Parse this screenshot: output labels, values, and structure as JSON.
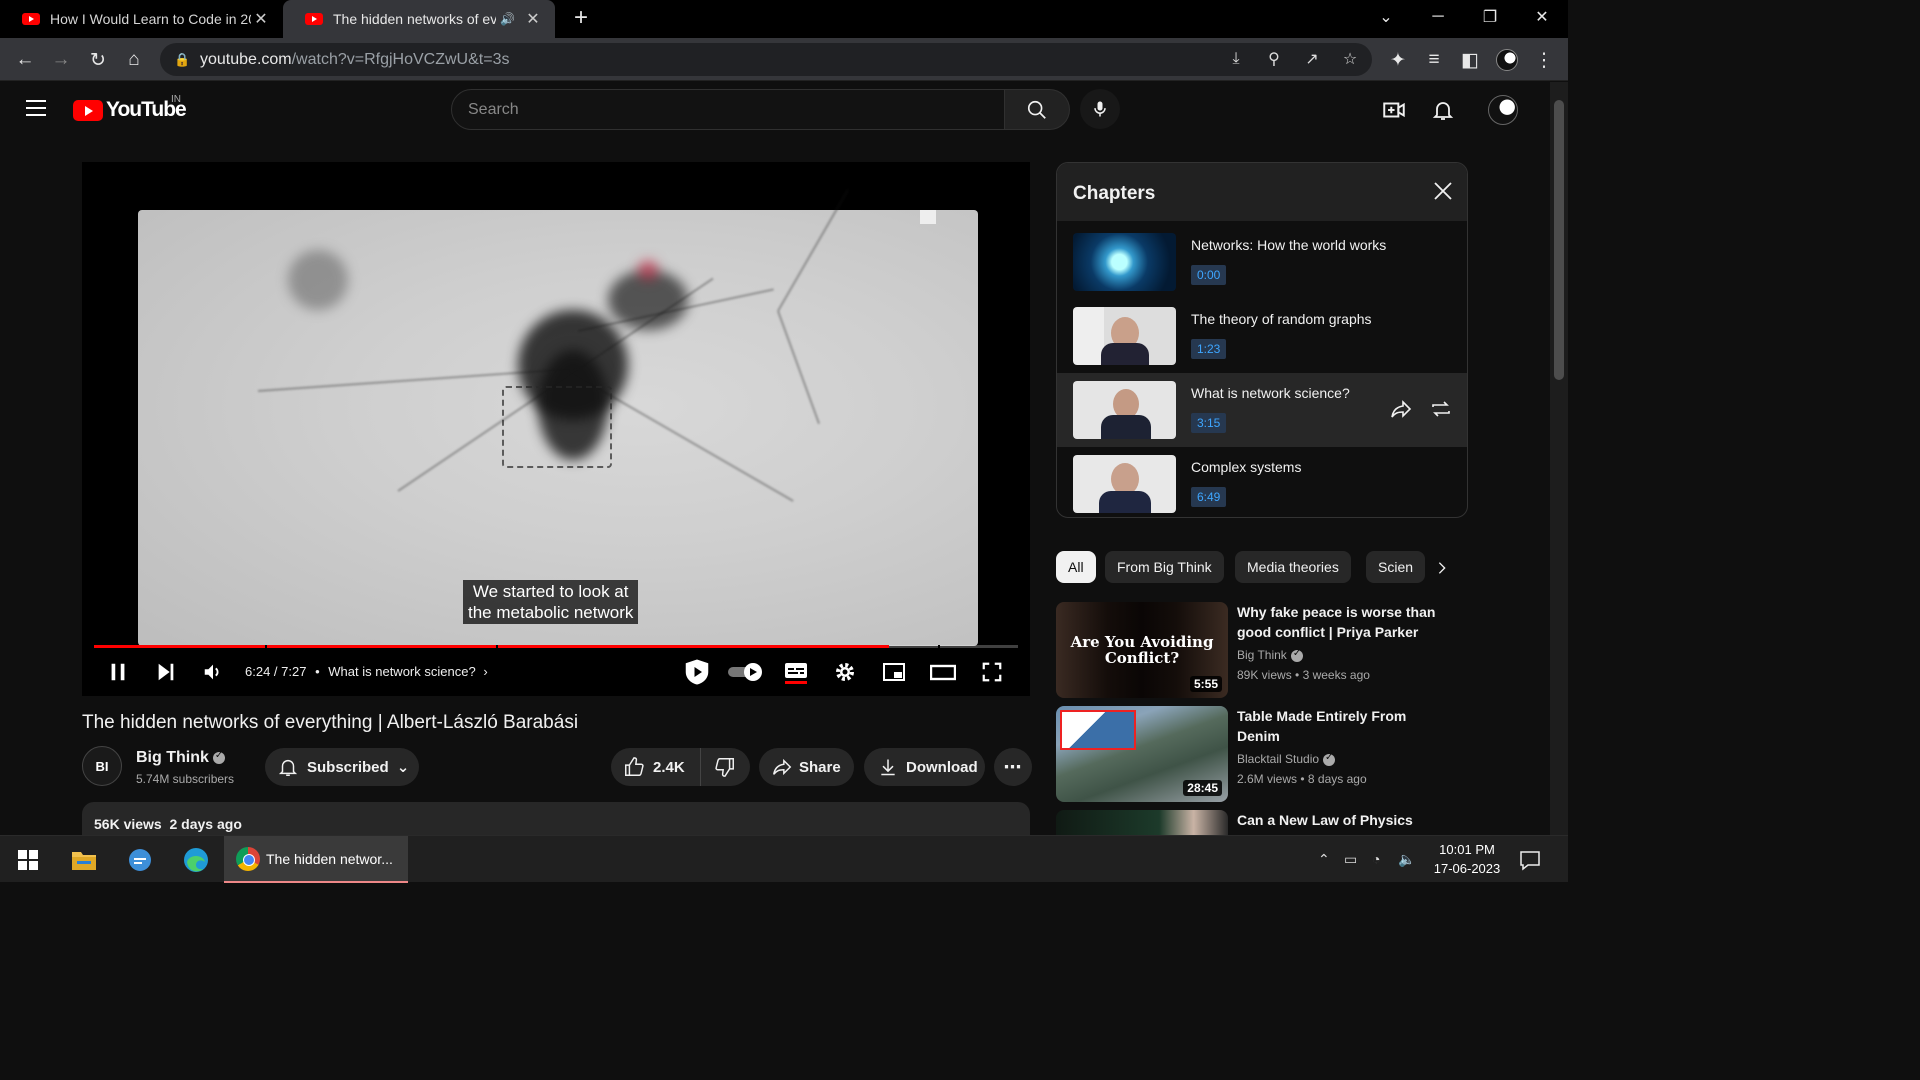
{
  "browser": {
    "tabs": [
      {
        "title": "How I Would Learn to Code in 20",
        "active": false
      },
      {
        "title": "The hidden networks of every",
        "active": true
      }
    ],
    "url_host": "youtube.com",
    "url_path": "/watch?v=RfgjHoVCZwU&t=3s"
  },
  "masthead": {
    "logo_text": "YouTube",
    "country": "IN",
    "search_placeholder": "Search"
  },
  "player": {
    "caption_line1": "We started to look at",
    "caption_line2": "the metabolic network",
    "current_time": "6:24",
    "duration": "7:27",
    "time_separator": " / ",
    "dot": "•",
    "chapter_label": "What is network science?",
    "progress_fraction": 0.86
  },
  "video": {
    "title": "The hidden networks of everything | Albert-László Barabási",
    "channel": "Big Think",
    "channel_initials": "BI",
    "subscribers": "5.74M subscribers",
    "subscribe_label": "Subscribed",
    "likes": "2.4K",
    "share_label": "Share",
    "download_label": "Download",
    "views": "56K views",
    "age": "2 days ago"
  },
  "chapters": {
    "heading": "Chapters",
    "items": [
      {
        "title": "Networks: How the world works",
        "time": "0:00",
        "current": false
      },
      {
        "title": "The theory of random graphs",
        "time": "1:23",
        "current": false
      },
      {
        "title": "What is network science?",
        "time": "3:15",
        "current": true
      },
      {
        "title": "Complex systems",
        "time": "6:49",
        "current": false
      }
    ]
  },
  "filters": {
    "chips": [
      "All",
      "From Big Think",
      "Media theories",
      "Scien"
    ]
  },
  "recommendations": [
    {
      "title_line1": "Why fake peace is worse than",
      "title_line2": "good conflict | Priya Parker",
      "channel": "Big Think",
      "views": "89K views",
      "age": "3 weeks ago",
      "duration": "5:55",
      "thumb_text": "Are You Avoiding Conflict?"
    },
    {
      "title_line1": "Table Made Entirely From",
      "title_line2": "Denim",
      "channel": "Blacktail Studio",
      "views": "2.6M views",
      "age": "8 days ago",
      "duration": "28:45"
    },
    {
      "title_line1": "Can a New Law of Physics",
      "title_line2": "",
      "channel": "",
      "views": "",
      "age": "",
      "duration": ""
    }
  ],
  "taskbar": {
    "app_title": "The hidden networ...",
    "time": "10:01 PM",
    "date": "17-06-2023"
  },
  "colors": {
    "accent": "#ff0000",
    "chapter_time": "#3ea6ff",
    "background": "#0f0f0f"
  }
}
